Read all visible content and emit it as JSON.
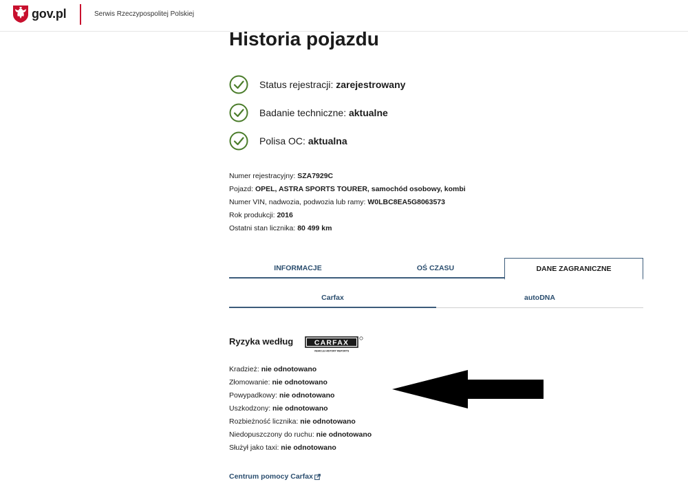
{
  "header": {
    "logo_text": "gov.pl",
    "service_name": "Serwis Rzeczypospolitej Polskiej"
  },
  "page": {
    "title": "Historia pojazdu"
  },
  "statuses": [
    {
      "label": "Status rejestracji: ",
      "value": "zarejestrowany",
      "icon": "check-circle-icon"
    },
    {
      "label": "Badanie techniczne: ",
      "value": "aktualne",
      "icon": "check-circle-icon"
    },
    {
      "label": "Polisa OC: ",
      "value": "aktualna",
      "icon": "check-circle-icon"
    }
  ],
  "details": [
    {
      "label": "Numer rejestracyjny: ",
      "value": "SZA7929C"
    },
    {
      "label": "Pojazd: ",
      "value": "OPEL, ASTRA SPORTS TOURER, samochód osobowy, kombi"
    },
    {
      "label": "Numer VIN, nadwozia, podwozia lub ramy: ",
      "value": "W0LBC8EA5G8063573"
    },
    {
      "label": "Rok produkcji: ",
      "value": "2016"
    },
    {
      "label": "Ostatni stan licznika: ",
      "value": "80 499 km"
    }
  ],
  "tabs": [
    {
      "label": "INFORMACJE",
      "active": false
    },
    {
      "label": "OŚ CZASU",
      "active": false
    },
    {
      "label": "DANE ZAGRANICZNE",
      "active": true
    }
  ],
  "subtabs": [
    {
      "label": "Carfax",
      "active": true
    },
    {
      "label": "autoDNA",
      "active": false
    }
  ],
  "risk_section": {
    "heading": "Ryzyka według",
    "logo_text": "CARFAX",
    "logo_subtext": "VEHICLE HISTORY REPORTS"
  },
  "risks": [
    {
      "label": "Kradzież: ",
      "value": "nie odnotowano"
    },
    {
      "label": "Złomowanie: ",
      "value": "nie odnotowano"
    },
    {
      "label": "Powypadkowy: ",
      "value": "nie odnotowano"
    },
    {
      "label": "Uszkodzony: ",
      "value": "nie odnotowano"
    },
    {
      "label": "Rozbieżność licznika: ",
      "value": "nie odnotowano"
    },
    {
      "label": "Niedopuszczony do ruchu: ",
      "value": "nie odnotowano"
    },
    {
      "label": "Służył jako taxi: ",
      "value": "nie odnotowano"
    }
  ],
  "help_link": {
    "label": "Centrum pomocy Carfax",
    "icon": "external-link-icon"
  },
  "colors": {
    "accent": "#2a4d6e",
    "brand_red": "#c8102e",
    "check_green": "#4a7c2a"
  }
}
